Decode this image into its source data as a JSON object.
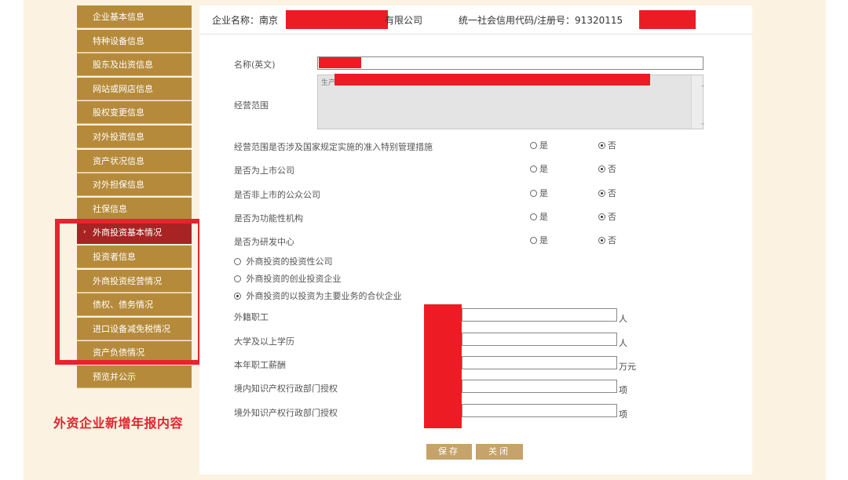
{
  "sidebar": {
    "items": [
      {
        "label": "企业基本信息"
      },
      {
        "label": "特种设备信息"
      },
      {
        "label": "股东及出资信息"
      },
      {
        "label": "网站或网店信息"
      },
      {
        "label": "股权变更信息"
      },
      {
        "label": "对外投资信息"
      },
      {
        "label": "资产状况信息"
      },
      {
        "label": "对外担保信息"
      },
      {
        "label": "社保信息"
      },
      {
        "label": "外商投资基本情况",
        "active": true
      },
      {
        "label": "投资者信息"
      },
      {
        "label": "外商投资经营情况"
      },
      {
        "label": "债权、债务情况"
      },
      {
        "label": "进口设备减免税情况"
      },
      {
        "label": "资产负债情况"
      },
      {
        "label": "预览并公示"
      }
    ],
    "chevron": "›",
    "annotation": "外资企业新增年报内容"
  },
  "header": {
    "company_label": "企业名称：南京",
    "company_suffix": "有限公司",
    "credit_label": "统一社会信用代码/注册号：91320115"
  },
  "form": {
    "english_name_label": "名称(英文)",
    "business_scope_label": "经营范围",
    "business_scope_prefix": "生产",
    "business_scope_tail": "）",
    "yes_label": "是",
    "no_label": "否",
    "questions": [
      {
        "label": "经营范围是否涉及国家规定实施的准入特别管理措施",
        "value": "否"
      },
      {
        "label": "是否为上市公司",
        "value": "否"
      },
      {
        "label": "是否非上市的公众公司",
        "value": "否"
      },
      {
        "label": "是否为功能性机构",
        "value": "否"
      },
      {
        "label": "是否为研发中心",
        "value": "否"
      }
    ],
    "company_types": [
      {
        "label": "外商投资的投资性公司",
        "selected": false
      },
      {
        "label": "外商投资的创业投资企业",
        "selected": false
      },
      {
        "label": "外商投资的以投资为主要业务的合伙企业",
        "selected": true
      }
    ],
    "stats": [
      {
        "label": "外籍职工",
        "unit": "人"
      },
      {
        "label": "大学及以上学历",
        "unit": "人"
      },
      {
        "label": "本年职工薪酬",
        "unit": "万元"
      },
      {
        "label": "境内知识产权行政部门授权",
        "unit": "项"
      },
      {
        "label": "境外知识产权行政部门授权",
        "unit": "项"
      }
    ]
  },
  "buttons": {
    "save": "保存",
    "close": "关闭"
  },
  "colors": {
    "sidebar_item": "#b58a3a",
    "sidebar_active": "#a82323",
    "annotation_red": "#e1252d",
    "button": "#c5a36a",
    "background": "#fbf2e2",
    "redaction": "#ed1c24"
  }
}
